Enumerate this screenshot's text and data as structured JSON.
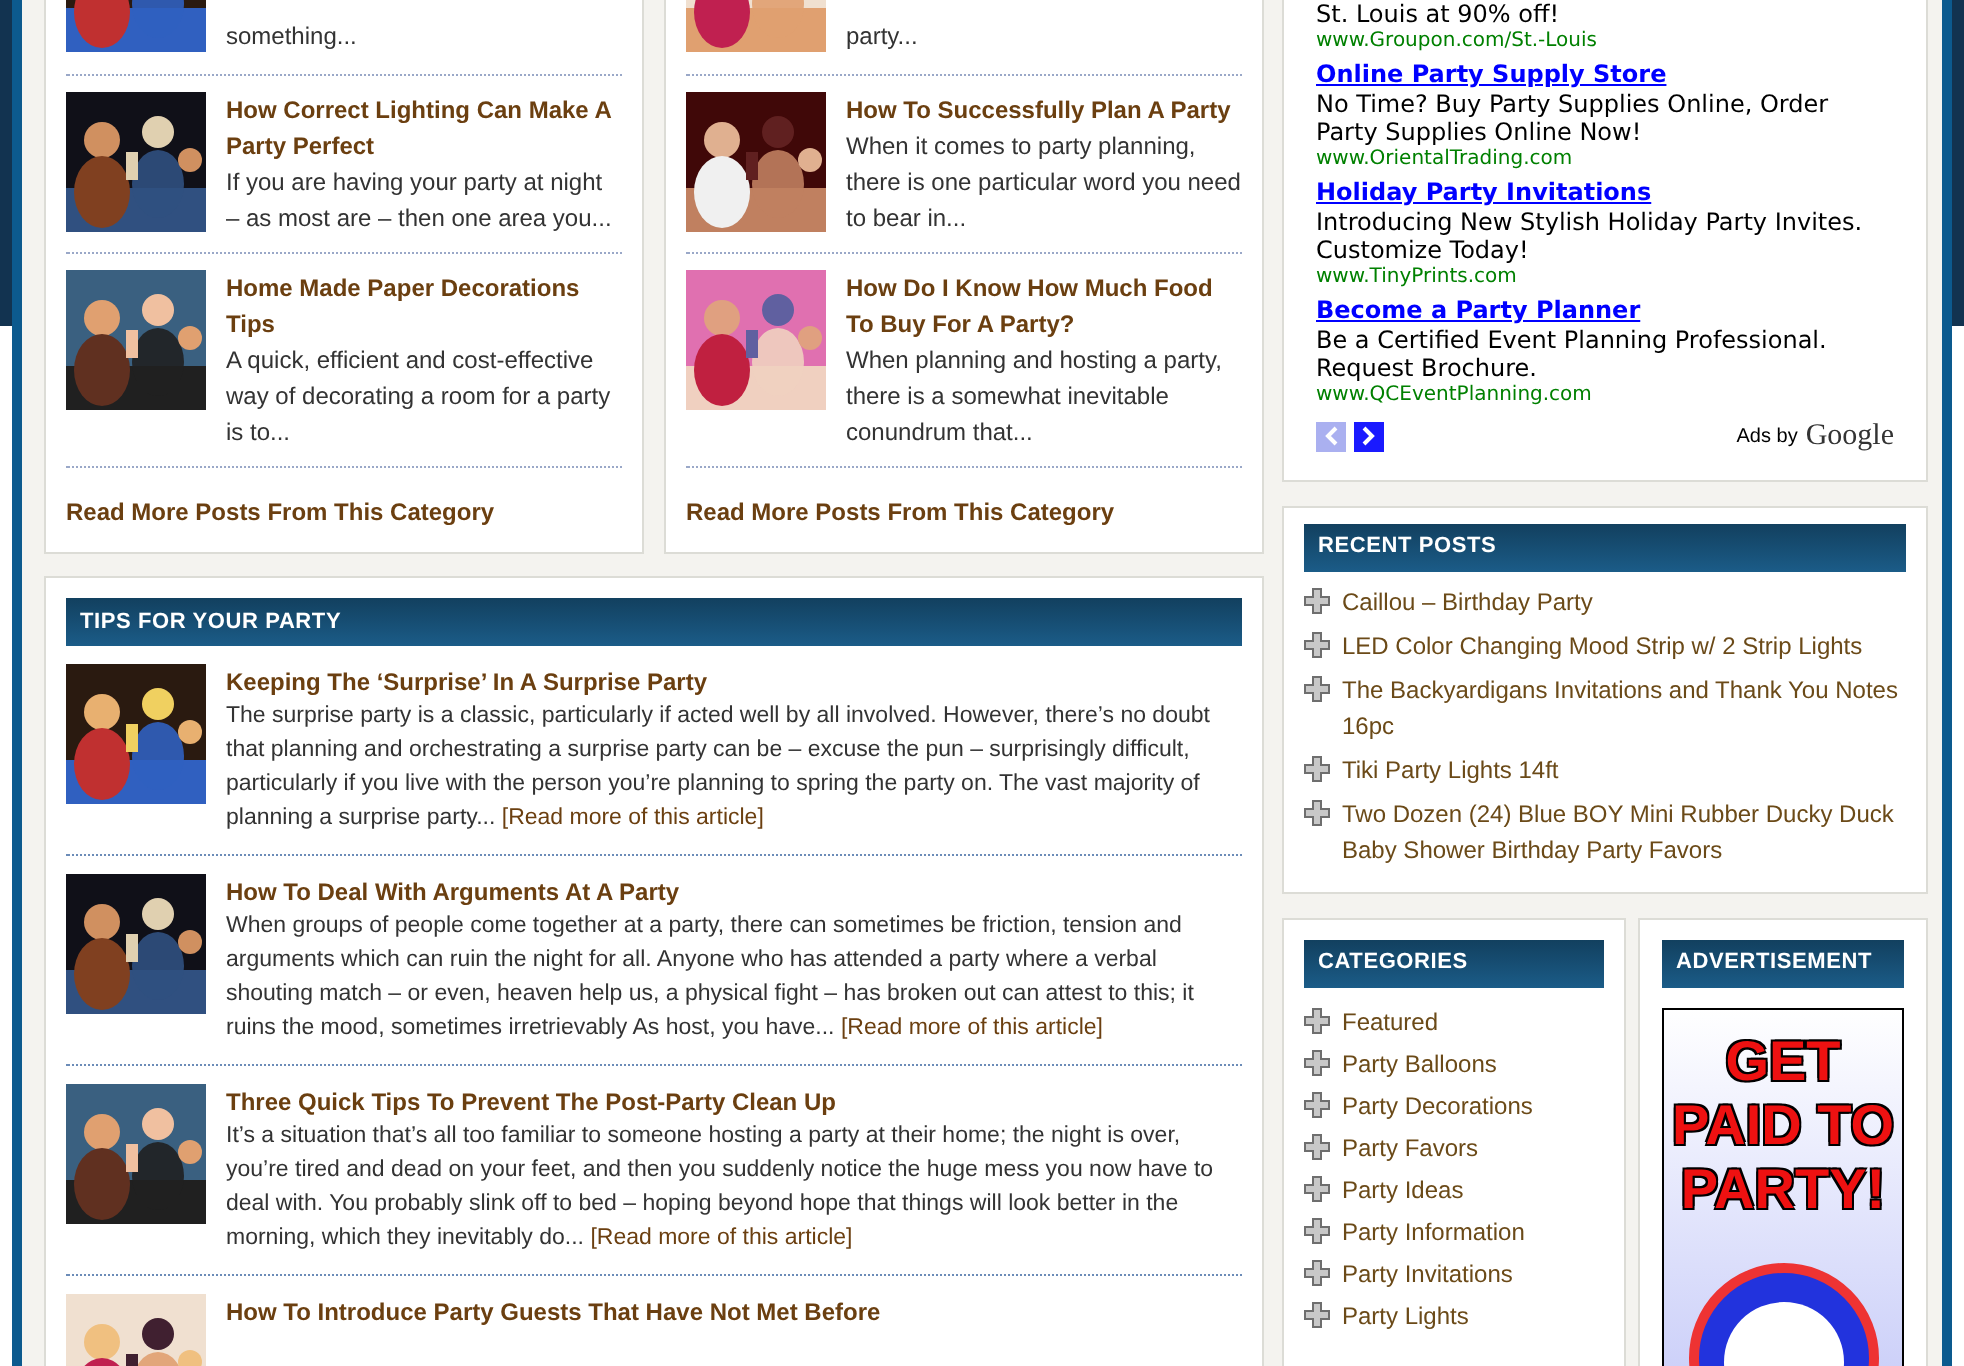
{
  "category_columns": [
    {
      "posts": [
        {
          "kind": "partial",
          "excerpt": "something..."
        },
        {
          "kind": "full",
          "title": "How Correct Lighting Can Make A Party Perfect",
          "excerpt": "If you are having your party at night – as most are – then one area you..."
        },
        {
          "kind": "full",
          "title": "Home Made Paper Decorations Tips",
          "excerpt": "A quick, efficient and cost-effective way of decorating a room for a party is to..."
        }
      ],
      "read_more": "Read More Posts From This Category"
    },
    {
      "posts": [
        {
          "kind": "partial",
          "excerpt": "party..."
        },
        {
          "kind": "full",
          "title": "How To Successfully Plan A Party",
          "excerpt": "When it comes to party planning, there is one particular word you need to bear in..."
        },
        {
          "kind": "full",
          "title": "How Do I Know How Much Food To Buy For A Party?",
          "excerpt": "When planning and hosting a party, there is a somewhat inevitable conundrum that..."
        }
      ],
      "read_more": "Read More Posts From This Category"
    }
  ],
  "tips": {
    "heading": "TIPS FOR YOUR PARTY",
    "articles": [
      {
        "title": "Keeping The ‘Surprise’ In A Surprise Party",
        "excerpt": "The surprise party is a classic, particularly if acted well by all involved. However, there’s no doubt that planning and orchestrating a surprise party can be – excuse the pun – surprisingly difficult, particularly if you live with the person you’re planning to spring the party on. The vast majority of planning a surprise party...",
        "link": "[Read more of this article]"
      },
      {
        "title": "How To Deal With Arguments At A Party",
        "excerpt": "When groups of people come together at a party, there can sometimes be friction, tension and arguments which can ruin the night for all. Anyone who has attended a party where a verbal shouting match – or even, heaven help us, a physical fight – has broken out can attest to this; it ruins the mood, sometimes irretrievably As host, you have...",
        "link": "[Read more of this article]"
      },
      {
        "title": "Three Quick Tips To Prevent The Post-Party Clean Up",
        "excerpt": "It’s a situation that’s all too familiar to someone hosting a party at their home; the night is over, you’re tired and dead on your feet, and then you suddenly notice the huge mess you now have to deal with. You probably slink off to bed – hoping beyond hope that things will look better in the morning, which they inevitably do...",
        "link": "[Read more of this article]"
      },
      {
        "title": "How To Introduce Party Guests That Have Not Met Before"
      }
    ]
  },
  "ads": {
    "items": [
      {
        "description": "St. Louis at 90% off!",
        "url": "www.Groupon.com/St.-Louis"
      },
      {
        "title": "Online Party Supply Store",
        "description": "No Time? Buy Party Supplies Online, Order Party Supplies Online Now!",
        "url": "www.OrientalTrading.com"
      },
      {
        "title": "Holiday Party Invitations",
        "description": "Introducing New Stylish Holiday Party Invites. Customize Today!",
        "url": "www.TinyPrints.com"
      },
      {
        "title": "Become a Party Planner",
        "description": "Be a Certified Event Planning Professional. Request Brochure.",
        "url": "www.QCEventPlanning.com"
      }
    ],
    "prev": {
      "disabled": true
    },
    "next": {
      "disabled": false
    },
    "attribution": "Ads by",
    "brand": "Google"
  },
  "recent_posts": {
    "heading": "RECENT POSTS",
    "items": [
      "Caillou – Birthday Party",
      "LED Color Changing Mood Strip w/ 2 Strip Lights",
      "The Backyardigans Invitations and Thank You Notes 16pc",
      "Tiki Party Lights 14ft",
      "Two Dozen (24) Blue BOY Mini Rubber Ducky Duck Baby Shower Birthday Party Favors"
    ]
  },
  "categories": {
    "heading": "CATEGORIES",
    "items": [
      "Featured",
      "Party Balloons",
      "Party Decorations",
      "Party Favors",
      "Party Ideas",
      "Party Information",
      "Party Invitations",
      "Party Lights"
    ]
  },
  "advertisement": {
    "heading": "ADVERTISEMENT",
    "banner": "GET PAID TO PARTY!"
  }
}
